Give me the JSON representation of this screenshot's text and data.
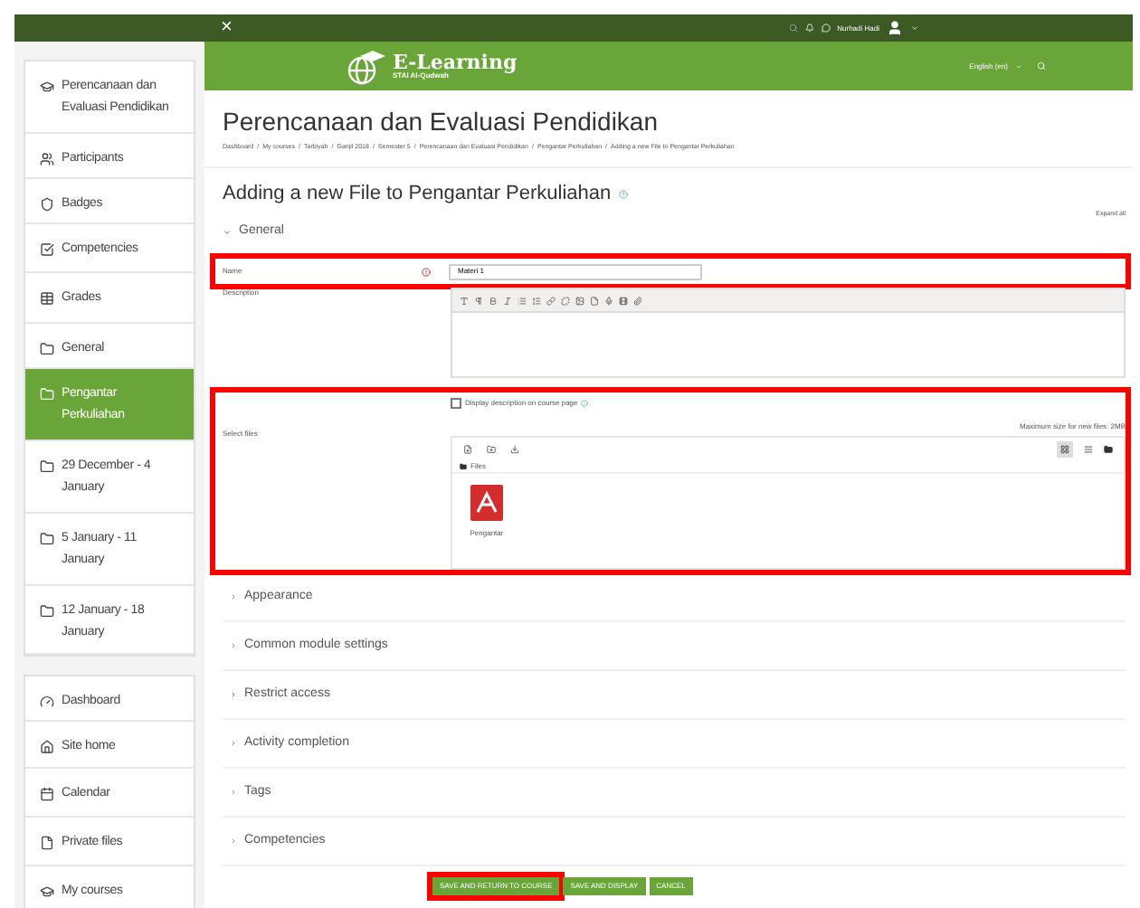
{
  "topbar": {
    "close": "×",
    "user": "Nurhadi Hadi"
  },
  "header": {
    "logo_title": "E-Learning",
    "logo_subtitle": "STAI Al-Qudwah",
    "language": "English (en)"
  },
  "sidebar": {
    "groups": [
      [
        {
          "label": "Perencanaan dan Evaluasi Pendidikan",
          "selected": false
        },
        {
          "label": "Participants",
          "selected": false
        },
        {
          "label": "Badges",
          "selected": false
        },
        {
          "label": "Competencies",
          "selected": false
        },
        {
          "label": "Grades",
          "selected": false
        },
        {
          "label": "General",
          "selected": false
        },
        {
          "label": "Pengantar Perkuliahan",
          "selected": true
        },
        {
          "label": "29 December - 4 January",
          "selected": false
        },
        {
          "label": "5 January - 11 January",
          "selected": false
        },
        {
          "label": "12 January - 18 January",
          "selected": false
        }
      ],
      [
        {
          "label": "Dashboard",
          "selected": false
        },
        {
          "label": "Site home",
          "selected": false
        },
        {
          "label": "Calendar",
          "selected": false
        },
        {
          "label": "Private files",
          "selected": false
        },
        {
          "label": "My courses",
          "selected": false
        }
      ]
    ]
  },
  "page_title": "Perencanaan dan Evaluasi Pendidikan",
  "breadcrumb_separator": "/",
  "breadcrumb": [
    "Dashboard",
    "My courses",
    "Tarbiyah",
    "Ganjil 2018",
    "Semester 5",
    "Perencanaan dan Evaluasi Pendidikan",
    "Pengantar Perkuliahan",
    "Adding a new File to Pengantar Perkuliahan"
  ],
  "form": {
    "heading": "Adding a new File to Pengantar Perkuliahan",
    "expand_all": "Expand all",
    "general": {
      "title": "General",
      "expanded": true
    },
    "name": {
      "label": "Name",
      "value": "Materi 1",
      "highlighted": true
    },
    "description": {
      "label": "Description"
    },
    "display_description": {
      "label": "Display description on course page",
      "checked": false
    },
    "select_files": {
      "label": "Select files",
      "max_size": "Maximum size for new files: 2MB",
      "folder": "Files",
      "file": "Pengantar",
      "highlighted": true
    },
    "sections": [
      {
        "title": "Appearance",
        "expanded": false
      },
      {
        "title": "Common module settings",
        "expanded": false
      },
      {
        "title": "Restrict access",
        "expanded": false
      },
      {
        "title": "Activity completion",
        "expanded": false
      },
      {
        "title": "Tags",
        "expanded": false
      },
      {
        "title": "Competencies",
        "expanded": false
      }
    ],
    "buttons": [
      {
        "label": "SAVE AND RETURN TO COURSE",
        "highlighted": true
      },
      {
        "label": "SAVE AND DISPLAY",
        "highlighted": false
      },
      {
        "label": "CANCEL",
        "highlighted": false
      }
    ]
  }
}
